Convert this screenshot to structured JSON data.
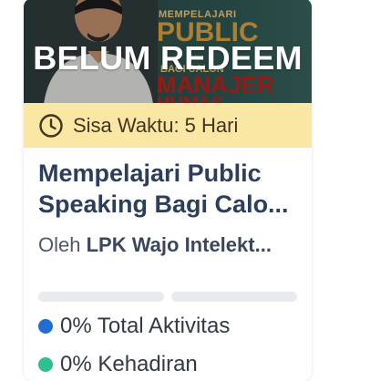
{
  "card": {
    "status_label": "BELUM REDEEM",
    "banner_text": {
      "top": "MEMPELAJARI",
      "public": "PUBLIC",
      "bagi": "BAGI CALON",
      "manajer": "MANAJER",
      "humas": "HUMAS"
    },
    "timer": {
      "icon": "clock-icon",
      "text": "Sisa Waktu: 5 Hari"
    },
    "title_lines": [
      "Mempelajari Public",
      "Speaking Bagi Calo..."
    ],
    "author_prefix": "Oleh",
    "author_org": "LPK Wajo Intelekt...",
    "progress": [
      {
        "label": "0% Total Aktivitas",
        "percent": 0,
        "color": "#1e6fd1"
      },
      {
        "label": "0% Kehadiran",
        "percent": 0,
        "color": "#2fbf8a"
      }
    ]
  },
  "colors": {
    "timer_bg": "#fbe7a4",
    "title": "#2c3e5b",
    "bar_track": "#e8eaed"
  }
}
